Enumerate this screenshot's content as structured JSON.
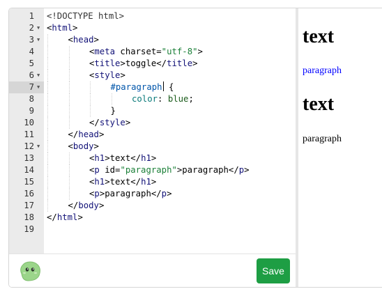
{
  "editor": {
    "lines": [
      {
        "n": "1",
        "fold": false,
        "active": false,
        "indent": 0,
        "tokens": [
          [
            "t-doc",
            "<!DOCTYPE html>"
          ]
        ]
      },
      {
        "n": "2",
        "fold": true,
        "active": false,
        "indent": 0,
        "tokens": [
          [
            "t-br",
            "<"
          ],
          [
            "t-tagname",
            "html"
          ],
          [
            "t-br",
            ">"
          ]
        ]
      },
      {
        "n": "3",
        "fold": true,
        "active": false,
        "indent": 1,
        "tokens": [
          [
            "t-br",
            "<"
          ],
          [
            "t-tagname",
            "head"
          ],
          [
            "t-br",
            ">"
          ]
        ]
      },
      {
        "n": "4",
        "fold": false,
        "active": false,
        "indent": 2,
        "tokens": [
          [
            "t-br",
            "<"
          ],
          [
            "t-tagname",
            "meta"
          ],
          [
            "t-attr",
            " charset"
          ],
          [
            "t-br",
            "="
          ],
          [
            "t-str",
            "\"utf-8\""
          ],
          [
            "t-br",
            ">"
          ]
        ]
      },
      {
        "n": "5",
        "fold": false,
        "active": false,
        "indent": 2,
        "tokens": [
          [
            "t-br",
            "<"
          ],
          [
            "t-tagname",
            "title"
          ],
          [
            "t-br",
            ">"
          ],
          [
            "t-attr",
            "toggle"
          ],
          [
            "t-br",
            "</"
          ],
          [
            "t-tagname",
            "title"
          ],
          [
            "t-br",
            ">"
          ]
        ]
      },
      {
        "n": "6",
        "fold": true,
        "active": false,
        "indent": 2,
        "tokens": [
          [
            "t-br",
            "<"
          ],
          [
            "t-tagname",
            "style"
          ],
          [
            "t-br",
            ">"
          ]
        ]
      },
      {
        "n": "7",
        "fold": true,
        "active": true,
        "indent": 3,
        "tokens": [
          [
            "t-sel",
            "#paragraph"
          ],
          [
            "cursor",
            ""
          ],
          [
            "t-br",
            " {"
          ]
        ]
      },
      {
        "n": "8",
        "fold": false,
        "active": false,
        "indent": 4,
        "tokens": [
          [
            "t-prop",
            "color"
          ],
          [
            "t-br",
            ": "
          ],
          [
            "t-val",
            "blue"
          ],
          [
            "t-br",
            ";"
          ]
        ]
      },
      {
        "n": "9",
        "fold": false,
        "active": false,
        "indent": 3,
        "tokens": [
          [
            "t-br",
            "}"
          ]
        ]
      },
      {
        "n": "10",
        "fold": false,
        "active": false,
        "indent": 2,
        "tokens": [
          [
            "t-br",
            "</"
          ],
          [
            "t-tagname",
            "style"
          ],
          [
            "t-br",
            ">"
          ]
        ]
      },
      {
        "n": "11",
        "fold": false,
        "active": false,
        "indent": 1,
        "tokens": [
          [
            "t-br",
            "</"
          ],
          [
            "t-tagname",
            "head"
          ],
          [
            "t-br",
            ">"
          ]
        ]
      },
      {
        "n": "12",
        "fold": true,
        "active": false,
        "indent": 1,
        "tokens": [
          [
            "t-br",
            "<"
          ],
          [
            "t-tagname",
            "body"
          ],
          [
            "t-br",
            ">"
          ]
        ]
      },
      {
        "n": "13",
        "fold": false,
        "active": false,
        "indent": 2,
        "tokens": [
          [
            "t-br",
            "<"
          ],
          [
            "t-tagname",
            "h1"
          ],
          [
            "t-br",
            ">"
          ],
          [
            "t-attr",
            "text"
          ],
          [
            "t-br",
            "</"
          ],
          [
            "t-tagname",
            "h1"
          ],
          [
            "t-br",
            ">"
          ]
        ]
      },
      {
        "n": "14",
        "fold": false,
        "active": false,
        "indent": 2,
        "tokens": [
          [
            "t-br",
            "<"
          ],
          [
            "t-tagname",
            "p"
          ],
          [
            "t-attr",
            " id"
          ],
          [
            "t-br",
            "="
          ],
          [
            "t-str",
            "\"paragraph\""
          ],
          [
            "t-br",
            ">"
          ],
          [
            "t-attr",
            "paragraph"
          ],
          [
            "t-br",
            "</"
          ],
          [
            "t-tagname",
            "p"
          ],
          [
            "t-br",
            ">"
          ]
        ]
      },
      {
        "n": "15",
        "fold": false,
        "active": false,
        "indent": 2,
        "tokens": [
          [
            "t-br",
            "<"
          ],
          [
            "t-tagname",
            "h1"
          ],
          [
            "t-br",
            ">"
          ],
          [
            "t-attr",
            "text"
          ],
          [
            "t-br",
            "</"
          ],
          [
            "t-tagname",
            "h1"
          ],
          [
            "t-br",
            ">"
          ]
        ]
      },
      {
        "n": "16",
        "fold": false,
        "active": false,
        "indent": 2,
        "tokens": [
          [
            "t-br",
            "<"
          ],
          [
            "t-tagname",
            "p"
          ],
          [
            "t-br",
            ">"
          ],
          [
            "t-attr",
            "paragraph"
          ],
          [
            "t-br",
            "</"
          ],
          [
            "t-tagname",
            "p"
          ],
          [
            "t-br",
            ">"
          ]
        ]
      },
      {
        "n": "17",
        "fold": false,
        "active": false,
        "indent": 1,
        "tokens": [
          [
            "t-br",
            "</"
          ],
          [
            "t-tagname",
            "body"
          ],
          [
            "t-br",
            ">"
          ]
        ]
      },
      {
        "n": "18",
        "fold": false,
        "active": false,
        "indent": 0,
        "tokens": [
          [
            "t-br",
            "</"
          ],
          [
            "t-tagname",
            "html"
          ],
          [
            "t-br",
            ">"
          ]
        ]
      },
      {
        "n": "19",
        "fold": false,
        "active": false,
        "indent": 0,
        "tokens": []
      }
    ]
  },
  "footer": {
    "save_label": "Save",
    "mascot_icon": "green-blob-mascot-icon",
    "save_color": "#1e9e44"
  },
  "preview": {
    "h1_first": "text",
    "p_first": "paragraph",
    "p_first_color": "#0000ff",
    "h1_second": "text",
    "p_second": "paragraph"
  }
}
